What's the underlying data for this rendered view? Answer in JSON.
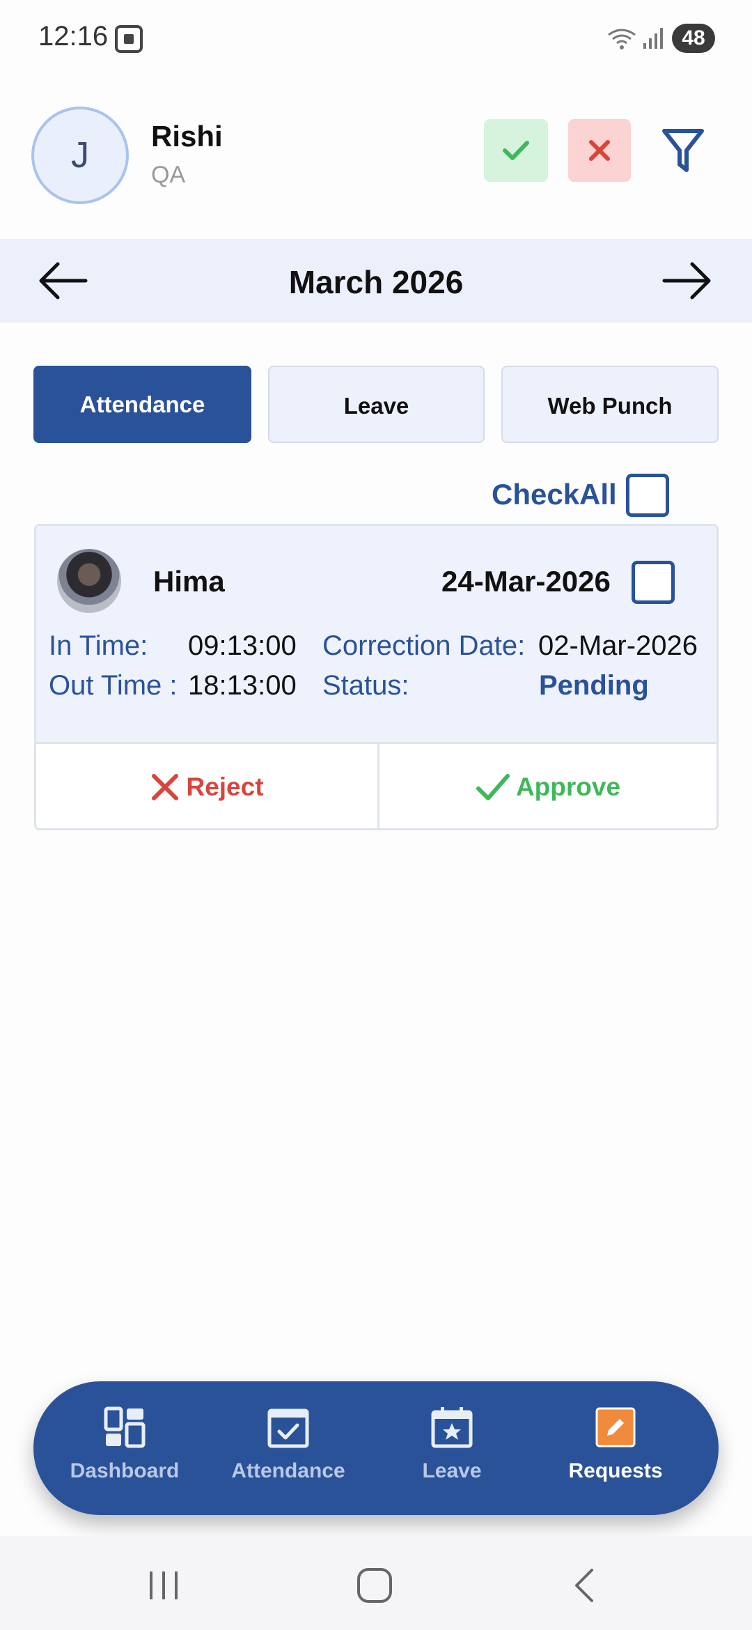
{
  "status_bar": {
    "time": "12:16",
    "battery": "48"
  },
  "header": {
    "avatar_initial": "J",
    "name": "Rishi",
    "role": "QA"
  },
  "month_nav": {
    "label": "March 2026"
  },
  "tabs": [
    {
      "label": "Attendance",
      "active": true
    },
    {
      "label": "Leave",
      "active": false
    },
    {
      "label": "Web Punch",
      "active": false
    }
  ],
  "check_all": {
    "label": "CheckAll",
    "checked": false
  },
  "requests": [
    {
      "name": "Hima",
      "date": "24-Mar-2026",
      "in_time_label": "In Time:",
      "in_time": "09:13:00",
      "out_time_label": "Out Time :",
      "out_time": "18:13:00",
      "correction_label": "Correction Date:",
      "correction_date": "02-Mar-2026",
      "status_label": "Status:",
      "status": "Pending",
      "reject_label": "Reject",
      "approve_label": "Approve"
    }
  ],
  "bottom_nav": [
    {
      "label": "Dashboard",
      "icon": "dashboard-icon",
      "active": false
    },
    {
      "label": "Attendance",
      "icon": "calendar-check-icon",
      "active": false
    },
    {
      "label": "Leave",
      "icon": "calendar-star-icon",
      "active": false
    },
    {
      "label": "Requests",
      "icon": "edit-request-icon",
      "active": true
    }
  ],
  "colors": {
    "primary": "#2a5298",
    "approve": "#3fb85a",
    "reject": "#d9443b",
    "accent_orange": "#f08a3c"
  }
}
